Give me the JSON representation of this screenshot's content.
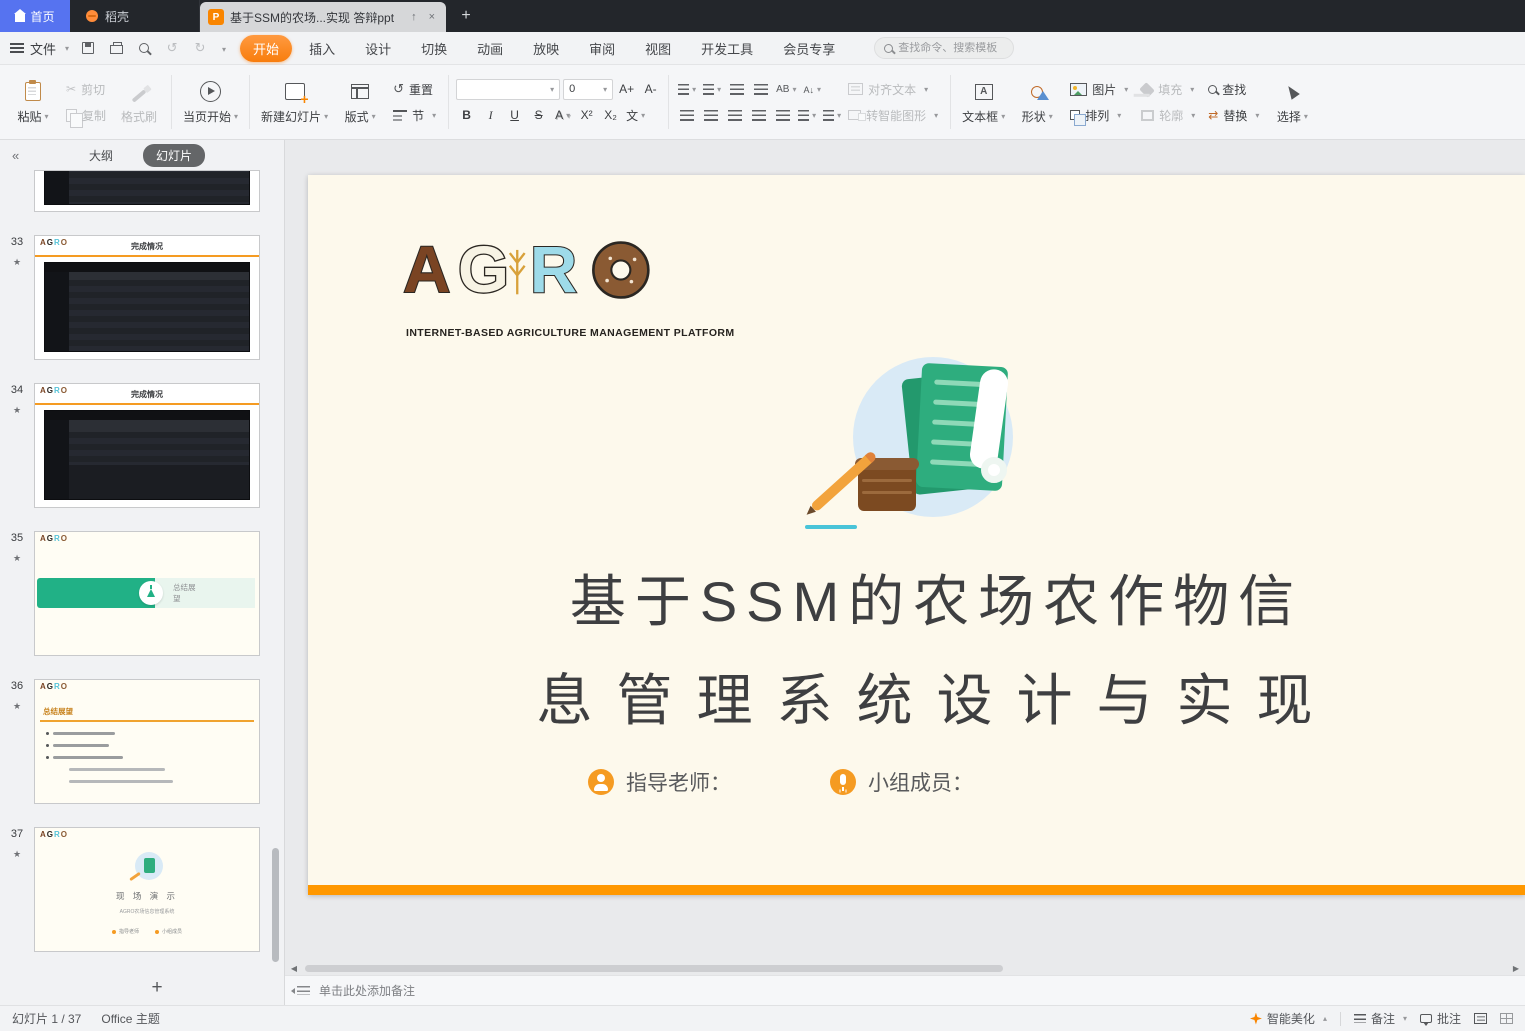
{
  "titlebar": {
    "home_tab": "首页",
    "docer_tab": "稻壳",
    "doc_icon_letter": "P",
    "doc_title": "基于SSM的农场...实现 答辩ppt",
    "up": "↑",
    "close": "×",
    "new_tab": "+"
  },
  "menubar": {
    "file_label": "文件",
    "undo": "↺",
    "redo": "↻",
    "tabs": [
      "开始",
      "插入",
      "设计",
      "切换",
      "动画",
      "放映",
      "审阅",
      "视图",
      "开发工具",
      "会员专享"
    ],
    "search_placeholder": "查找命令、搜索模板"
  },
  "ribbon": {
    "paste": "粘贴",
    "cut": "剪切",
    "copy": "复制",
    "format_painter": "格式刷",
    "start_current": "当页开始",
    "new_slide": "新建幻灯片",
    "layout": "版式",
    "reset": "重置",
    "section": "节",
    "font_size": "0",
    "inc_font": "A+",
    "dec_font": "A-",
    "bold": "B",
    "italic": "I",
    "underline": "U",
    "strike": "S",
    "shadow": "A",
    "sup": "X²",
    "sub": "X₂",
    "highlight": "文",
    "ab": "AB",
    "align_text": "对齐文本",
    "to_smartart": "转智能图形",
    "text_box": "文本框",
    "shapes": "形状",
    "picture": "图片",
    "fill": "填充",
    "arrange": "排列",
    "outline": "轮廓",
    "find": "查找",
    "replace": "替换",
    "select": "选择"
  },
  "sidebar": {
    "collapse": "«",
    "outline_tab": "大纲",
    "slides_tab": "幻灯片",
    "star": "★",
    "add": "+",
    "scroll_left": "◀",
    "scroll_right": "▶",
    "slides": [
      {
        "num": "33",
        "title": "完成情况"
      },
      {
        "num": "34",
        "title": "完成情况"
      },
      {
        "num": "35",
        "banner_line1": "总结展",
        "banner_line2": "望"
      },
      {
        "num": "36",
        "title": "总结展望"
      },
      {
        "num": "37",
        "title": "现 场 演 示",
        "caption": "AGRO农场信息管理系统",
        "dot1": "指导老师",
        "dot2": "小组成员"
      }
    ]
  },
  "slide": {
    "logo": {
      "a": "A",
      "g": "G",
      "r": "R",
      "o": "O"
    },
    "tagline": "INTERNET-BASED AGRICULTURE MANAGEMENT PLATFORM",
    "title_line1": "基于SSM的农场农作物信",
    "title_line2": "息管理系统设计与实现",
    "advisor": "指导老师：",
    "team": "小组成员："
  },
  "notes": {
    "placeholder": "单击此处添加备注"
  },
  "statusbar": {
    "counter": "幻灯片 1 / 37",
    "theme": "Office 主题",
    "beautify": "智能美化",
    "notes_label": "备注",
    "comments_label": "批注"
  }
}
